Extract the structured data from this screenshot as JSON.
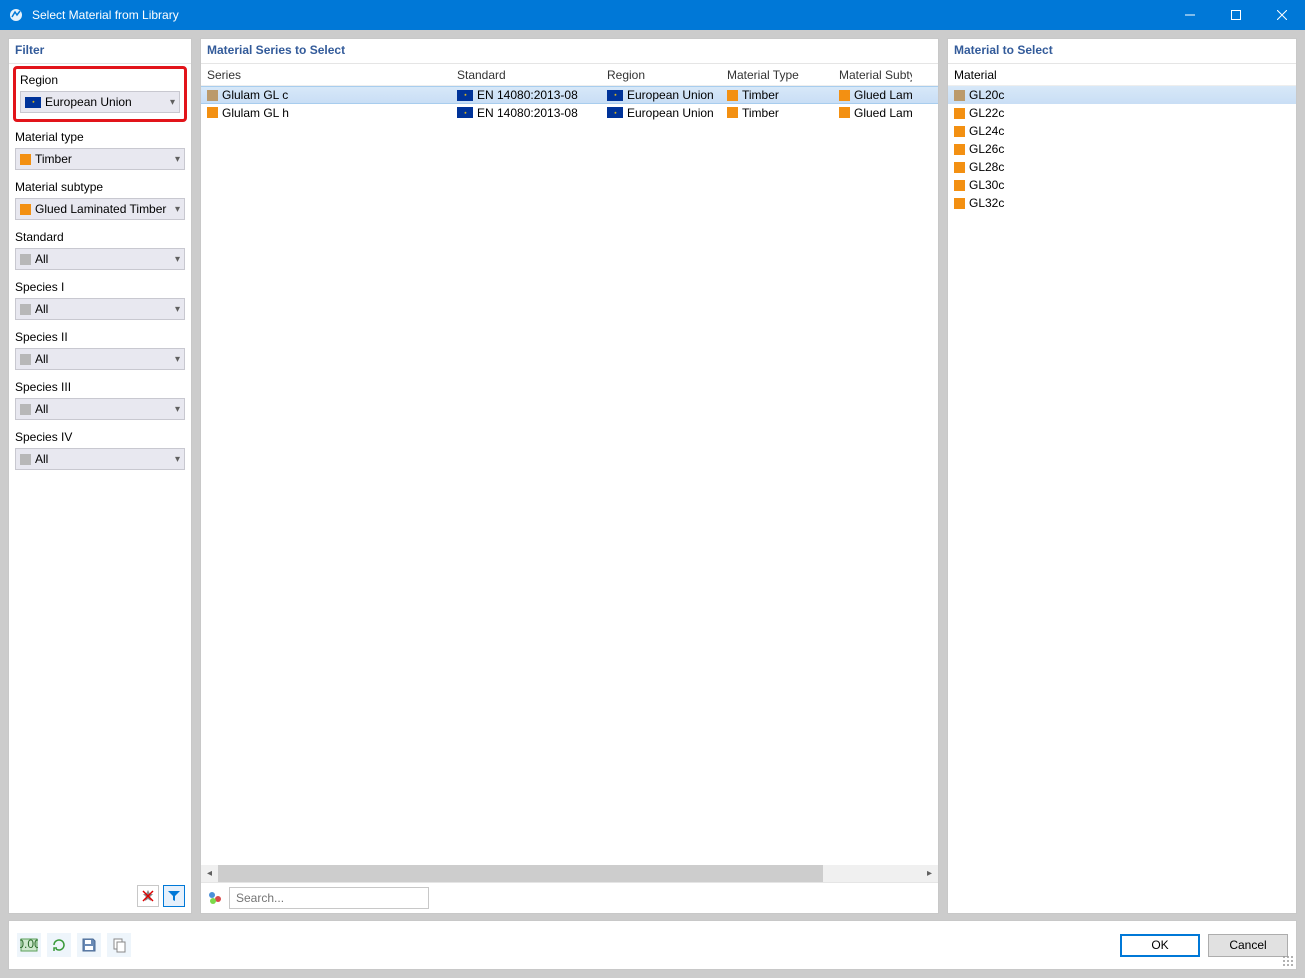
{
  "window": {
    "title": "Select Material from Library"
  },
  "panels": {
    "filter": "Filter",
    "series": "Material Series to Select",
    "material": "Material to Select"
  },
  "filters": {
    "region": {
      "label": "Region",
      "value": "European Union"
    },
    "mtype": {
      "label": "Material type",
      "value": "Timber"
    },
    "msub": {
      "label": "Material subtype",
      "value": "Glued Laminated Timber"
    },
    "standard": {
      "label": "Standard",
      "value": "All"
    },
    "sp1": {
      "label": "Species I",
      "value": "All"
    },
    "sp2": {
      "label": "Species II",
      "value": "All"
    },
    "sp3": {
      "label": "Species III",
      "value": "All"
    },
    "sp4": {
      "label": "Species IV",
      "value": "All"
    }
  },
  "series_headers": {
    "series": "Series",
    "standard": "Standard",
    "region": "Region",
    "mtype": "Material Type",
    "msub": "Material Subtype"
  },
  "series_rows": [
    {
      "series": "Glulam GL c",
      "sw": "tan",
      "standard": "EN 14080:2013-08",
      "region": "European Union",
      "mtype": "Timber",
      "msub": "Glued Laminated Timber"
    },
    {
      "series": "Glulam GL h",
      "sw": "orange",
      "standard": "EN 14080:2013-08",
      "region": "European Union",
      "mtype": "Timber",
      "msub": "Glued Laminated Timber"
    }
  ],
  "material_header": "Material",
  "materials": [
    {
      "name": "GL20c",
      "sw": "tan"
    },
    {
      "name": "GL22c",
      "sw": "orange"
    },
    {
      "name": "GL24c",
      "sw": "orange"
    },
    {
      "name": "GL26c",
      "sw": "orange"
    },
    {
      "name": "GL28c",
      "sw": "orange"
    },
    {
      "name": "GL30c",
      "sw": "orange"
    },
    {
      "name": "GL32c",
      "sw": "orange"
    }
  ],
  "search": {
    "placeholder": "Search..."
  },
  "buttons": {
    "ok": "OK",
    "cancel": "Cancel"
  }
}
